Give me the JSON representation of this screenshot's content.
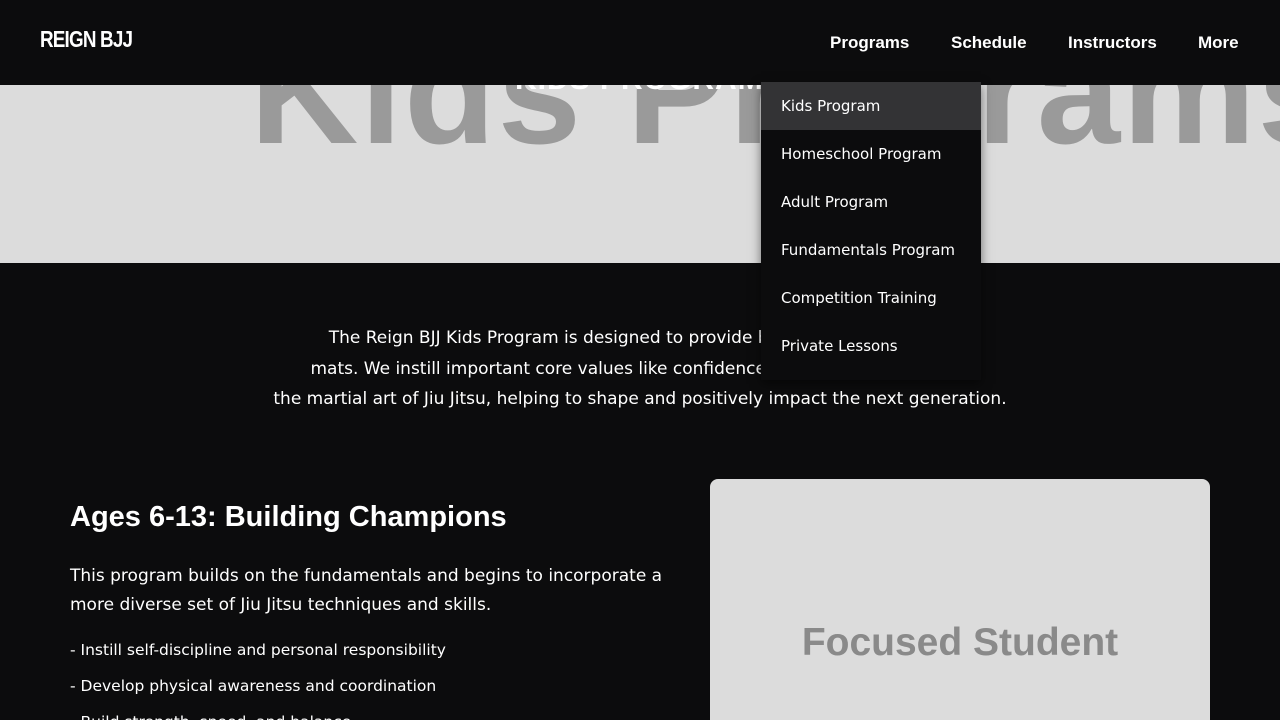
{
  "header": {
    "logo": "REIGN BJJ",
    "nav": [
      {
        "label": "Programs"
      },
      {
        "label": "Schedule"
      },
      {
        "label": "Instructors"
      },
      {
        "label": "More"
      }
    ]
  },
  "programs_menu": {
    "items": [
      {
        "label": "Kids Program",
        "active": true
      },
      {
        "label": "Homeschool Program"
      },
      {
        "label": "Adult Program"
      },
      {
        "label": "Fundamentals Program"
      },
      {
        "label": "Competition Training"
      },
      {
        "label": "Private Lessons"
      }
    ]
  },
  "hero": {
    "big_text": "Kids Programs",
    "overlay_text": "KIDS PROGRAMS"
  },
  "intro": {
    "line1": "The Reign BJJ Kids Program is designed to provide benefits on and off the",
    "line2": "mats. We instill important core values like confidence, self-discipline, through",
    "line3": "the martial art of Jiu Jitsu, helping to shape and positively impact the next generation."
  },
  "section": {
    "title": "Ages 6-13: Building Champions",
    "description": "This program builds on the fundamentals and begins to incorporate a more diverse set of Jiu Jitsu techniques and skills.",
    "bullets": [
      "- Instill self-discipline and personal responsibility",
      "- Develop physical awareness and coordination",
      "- Build strength, speed, and balance"
    ]
  },
  "image_placeholder": {
    "label": "Focused Student"
  },
  "colors": {
    "background": "#0c0c0d",
    "hero_background": "#dcdcdc",
    "dropdown_active": "#333335",
    "text": "#ffffff"
  }
}
